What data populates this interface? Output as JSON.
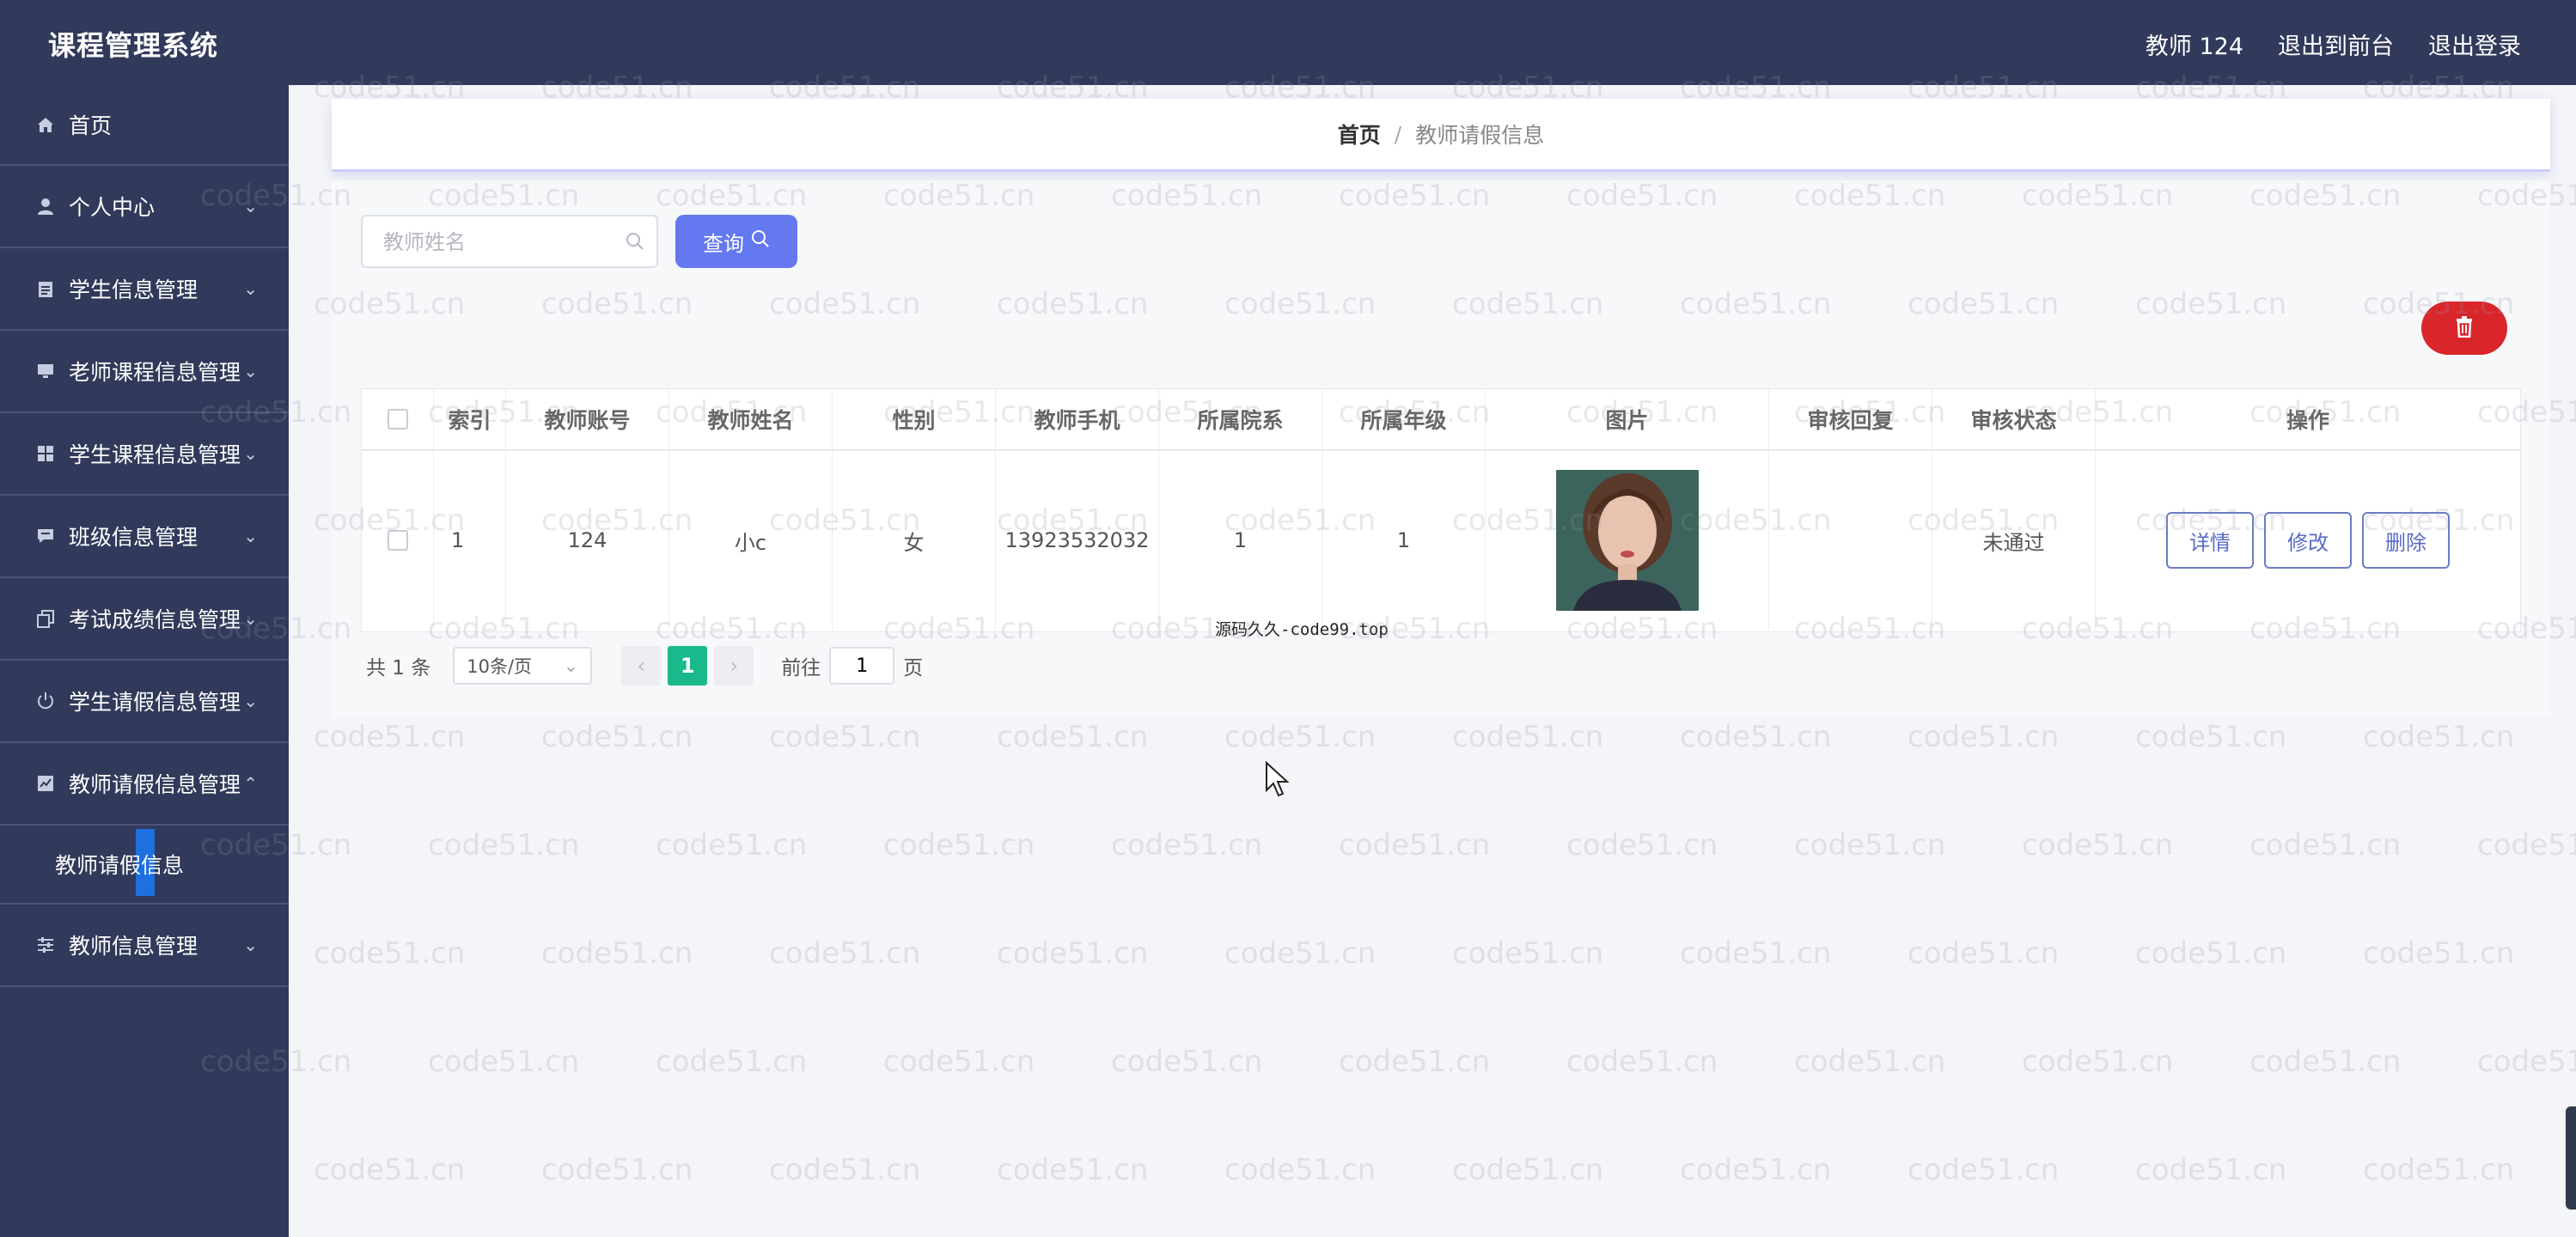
{
  "app": {
    "title": "课程管理系统"
  },
  "header": {
    "user_label": "教师 124",
    "back_front": "退出到前台",
    "logout": "退出登录"
  },
  "sidebar": {
    "items": [
      {
        "label": "首页",
        "icon": "home-icon"
      },
      {
        "label": "个人中心",
        "icon": "user-icon"
      },
      {
        "label": "学生信息管理",
        "icon": "clipboard-icon"
      },
      {
        "label": "老师课程信息管理",
        "icon": "monitor-icon"
      },
      {
        "label": "学生课程信息管理",
        "icon": "grid-icon"
      },
      {
        "label": "班级信息管理",
        "icon": "message-icon"
      },
      {
        "label": "考试成绩信息管理",
        "icon": "copy-icon"
      },
      {
        "label": "学生请假信息管理",
        "icon": "power-icon"
      },
      {
        "label": "教师请假信息管理",
        "icon": "chart-icon"
      },
      {
        "label": "教师请假信息",
        "sub": true,
        "active": true
      },
      {
        "label": "教师信息管理",
        "icon": "sliders-icon"
      }
    ]
  },
  "breadcrumb": {
    "home": "首页",
    "separator": "/",
    "current": "教师请假信息"
  },
  "search": {
    "placeholder": "教师姓名",
    "button": "查询"
  },
  "table": {
    "columns": [
      "索引",
      "教师账号",
      "教师姓名",
      "性别",
      "教师手机",
      "所属院系",
      "所属年级",
      "图片",
      "审核回复",
      "审核状态",
      "操作"
    ],
    "rows": [
      {
        "index": "1",
        "account": "124",
        "name": "小c",
        "gender": "女",
        "phone": "13923532032",
        "dept": "1",
        "grade": "1",
        "reply": "",
        "status": "未通过"
      }
    ],
    "actions": {
      "detail": "详情",
      "edit": "修改",
      "delete": "删除"
    }
  },
  "pagination": {
    "total": "共 1 条",
    "page_size": "10条/页",
    "current_page": "1",
    "goto_label": "前往",
    "goto_value": "1",
    "page_suffix": "页"
  },
  "source_note": "源码久久-code99.top",
  "watermark_text": "code51.cn",
  "colors": {
    "sidebar_bg": "#313a5a",
    "accent": "#6478f0",
    "danger": "#d9262b",
    "page_active": "#19b98c"
  }
}
